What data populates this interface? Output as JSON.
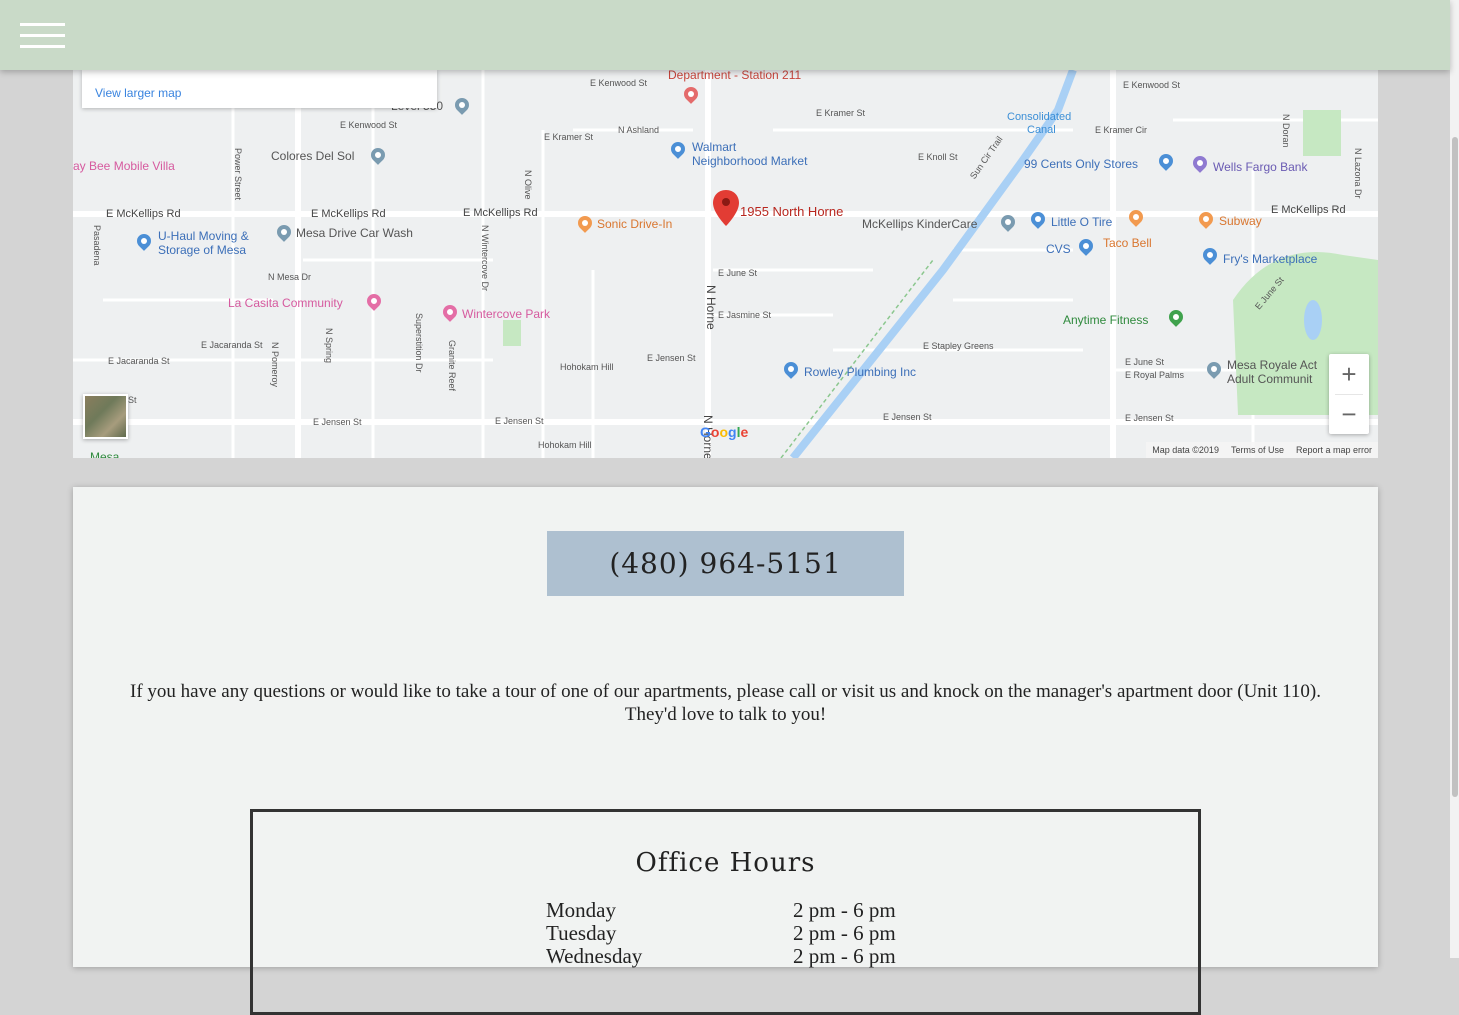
{
  "header": {
    "menu_icon": "hamburger-icon",
    "background": "#c9dac8"
  },
  "map": {
    "view_larger": "View larger map",
    "marker_label": "1955 North Horne",
    "places": {
      "fire_dept": "Department - Station 211",
      "walmart_1": "Walmart",
      "walmart_2": "Neighborhood Market",
      "level550": "Level 550",
      "colores": "Colores Del Sol",
      "bee_mobile": "ay Bee Mobile Villa",
      "uhaul_1": "U-Haul Moving &",
      "uhaul_2": "Storage of Mesa",
      "car_wash": "Mesa Drive Car Wash",
      "la_casita": "La Casita Community",
      "wintercove": "Wintercove Park",
      "sonic": "Sonic Drive-In",
      "kindercare": "McKellips KinderCare",
      "little_o": "Little O Tire",
      "cvs": "CVS",
      "taco_bell": "Taco Bell",
      "subway": "Subway",
      "frys": "Fry's Marketplace",
      "cents99": "99 Cents Only Stores",
      "wells": "Wells Fargo Bank",
      "canal_1": "Consolidated",
      "canal_2": "Canal",
      "anytime": "Anytime Fitness",
      "rowley": "Rowley Plumbing Inc",
      "mesa_royale_1": "Mesa Royale Act",
      "mesa_royale_2": "Adult Communit",
      "mesa": "Mesa"
    },
    "streets": {
      "kenwood_1": "E Kenwood St",
      "kenwood_2": "E Kenwood St",
      "kenwood_3": "E Kenwood St",
      "kramer_1": "E Kramer St",
      "kramer_2": "E Kramer St",
      "kramer_cir": "E Kramer Cir",
      "ashland": "N Ashland",
      "knoll": "E Knoll St",
      "mckellips_1": "E McKellips Rd",
      "mckellips_2": "E McKellips Rd",
      "mckellips_3": "E McKellips Rd",
      "mckellips_4": "E McKellips Rd",
      "power": "Power Street",
      "olive": "N Olive",
      "pasadena": "Pasadena",
      "wintercove_dr": "N Wintercove Dr",
      "mesa_dr": "N Mesa Dr",
      "june_1": "E June St",
      "june_2": "E June St",
      "june_3": "E June St",
      "jasmine": "E Jasmine St",
      "horne": "N Horne",
      "horne_2": "N Horne",
      "jacaranda_1": "E Jacaranda St",
      "jacaranda_2": "E Jacaranda St",
      "pomeroy": "N Pomeroy",
      "spring": "N Spring",
      "superstition": "Superstition Dr",
      "granite": "Granite Reef",
      "hohokam_1": "Hohokam Hill",
      "hohokam_2": "Hohokam Hill",
      "jensen_1": "E Jensen St",
      "jensen_2": "E Jensen St",
      "jensen_3": "E Jensen St",
      "jensen_4": "E Jensen St",
      "jensen_5": "E Jensen St",
      "stapley": "E Stapley Greens",
      "royal_palms": "E Royal Palms",
      "sun_cir": "Sun Cir Trail",
      "doran": "N Doran",
      "lazona": "N Lazona Dr",
      "st": "St"
    },
    "zoom_in": "+",
    "zoom_out": "−",
    "google": "Google",
    "footer": {
      "data": "Map data ©2019",
      "terms": "Terms of Use",
      "report": "Report a map error"
    }
  },
  "contact": {
    "phone": "(480) 964-5151",
    "intro": "If you have any questions or would like to take a tour of one of our apartments, please call or visit us and knock on the manager's apartment door (Unit 110). They'd love to talk to you!"
  },
  "hours": {
    "title": "Office Hours",
    "rows": [
      {
        "day": "Monday",
        "time": "2 pm - 6 pm"
      },
      {
        "day": "Tuesday",
        "time": "2 pm - 6 pm"
      },
      {
        "day": "Wednesday",
        "time": "2 pm - 6 pm"
      }
    ]
  }
}
